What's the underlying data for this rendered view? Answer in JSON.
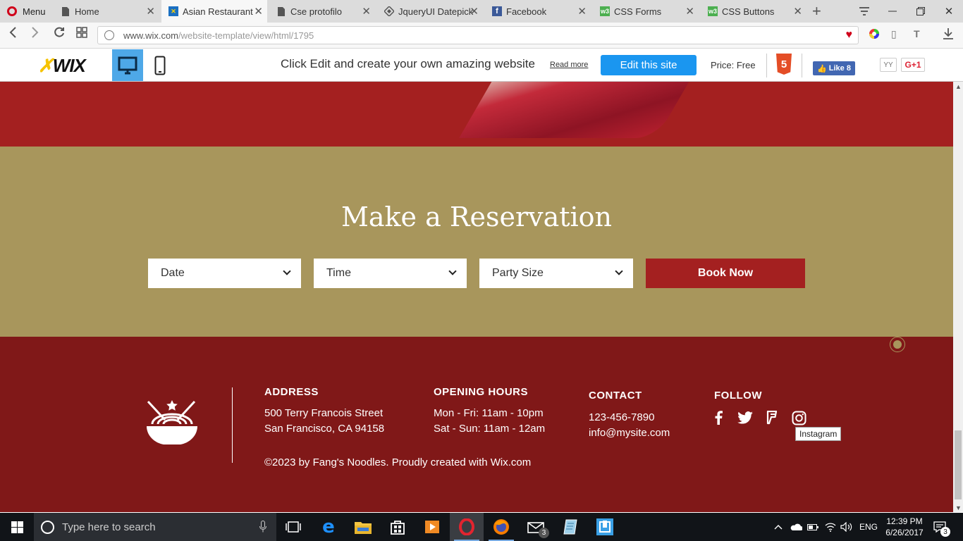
{
  "browser": {
    "menu_label": "Menu",
    "tabs": [
      {
        "title": "Home"
      },
      {
        "title": "Asian Restaurant W"
      },
      {
        "title": "Cse protofilo"
      },
      {
        "title": "JqueryUI Datepick"
      },
      {
        "title": "Facebook"
      },
      {
        "title": "CSS Forms"
      },
      {
        "title": "CSS Buttons"
      }
    ],
    "url_host": "www.wix.com",
    "url_path": "/website-template/view/html/1795"
  },
  "wix_bar": {
    "logo": "WIX",
    "promo_text": "Click Edit and create your own amazing website",
    "read_more": "Read more",
    "edit_button": "Edit this site",
    "price": "Price: Free",
    "fb_like": "Like 8",
    "gplus": "G+1",
    "yy": "YY"
  },
  "reservation": {
    "title": "Make a Reservation",
    "date_placeholder": "Date",
    "time_placeholder": "Time",
    "party_placeholder": "Party Size",
    "book_button": "Book Now"
  },
  "footer": {
    "address_heading": "ADDRESS",
    "address_line1": "500 Terry Francois Street",
    "address_line2": "San Francisco, CA 94158",
    "hours_heading": "OPENING HOURS",
    "hours_line1": "Mon - Fri: 11am - 10pm",
    "hours_line2": "Sat - Sun: 11am - 12am",
    "contact_heading": "CONTACT",
    "phone": "123-456-7890",
    "email": "info@mysite.com",
    "follow_heading": "FOLLOW",
    "copyright": "©2023 by Fang's Noodles. Proudly created with Wix.com",
    "tooltip": "Instagram",
    "social_icons": [
      "facebook-icon",
      "twitter-icon",
      "foursquare-icon",
      "instagram-icon"
    ]
  },
  "taskbar": {
    "search_placeholder": "Type here to search",
    "language": "ENG",
    "time": "12:39 PM",
    "date": "6/26/2017",
    "mail_badge": "3",
    "notif_badge": "3"
  },
  "colors": {
    "brand_red": "#a42020",
    "footer_red": "#801818",
    "gold": "#a8965c",
    "wix_blue": "#1a96f0"
  }
}
